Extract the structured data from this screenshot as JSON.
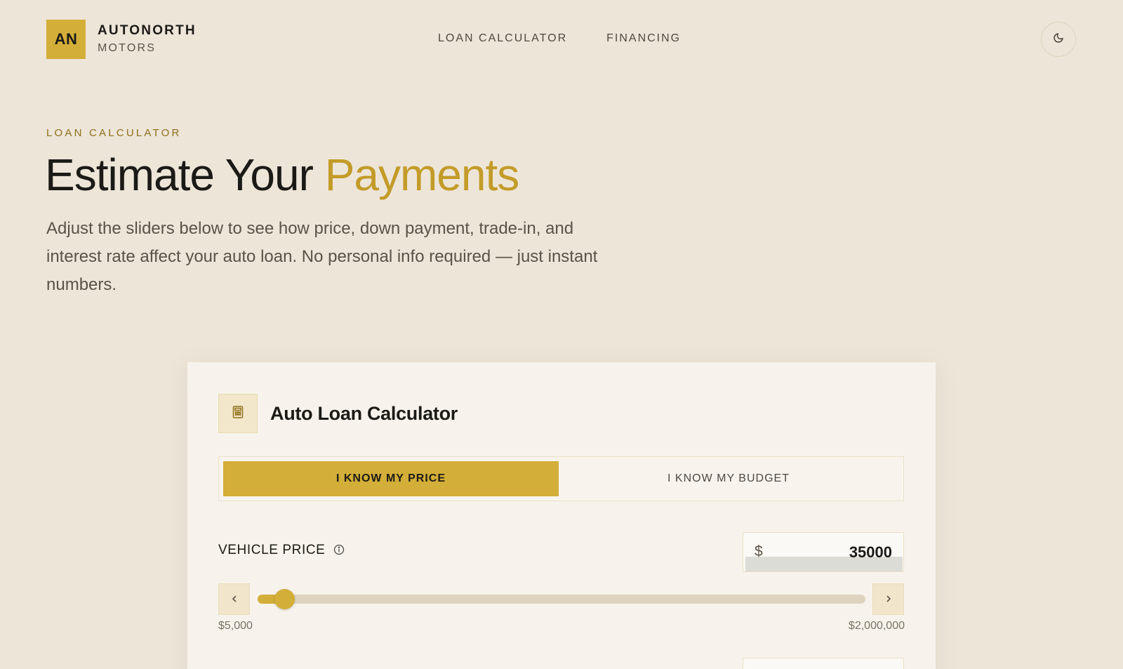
{
  "brand": {
    "monogram": "AN",
    "name": "AUTONORTH",
    "sub": "MOTORS",
    "accent_color": "#d3ae38"
  },
  "nav": {
    "items": [
      "LOAN CALCULATOR",
      "FINANCING"
    ]
  },
  "theme_toggle": {
    "icon": "moon-icon"
  },
  "hero": {
    "eyebrow": "LOAN CALCULATOR",
    "title_main": "Estimate Your ",
    "title_accent": "Payments",
    "description": "Adjust the sliders below to see how price, down payment, trade-in, and interest rate affect your auto loan. No personal info required — just instant numbers."
  },
  "calculator": {
    "icon": "calculator-icon",
    "title": "Auto Loan Calculator",
    "modes": [
      {
        "label": "I KNOW MY PRICE",
        "active": true
      },
      {
        "label": "I KNOW MY BUDGET",
        "active": false
      }
    ],
    "vehicle_price": {
      "label": "VEHICLE PRICE",
      "info_icon": "info-icon",
      "currency": "$",
      "value": "35000",
      "min_label": "$5,000",
      "max_label": "$2,000,000",
      "min": 5000,
      "max": 2000000,
      "current": 35000,
      "decrement_icon": "chevron-left-icon",
      "increment_icon": "chevron-right-icon"
    }
  }
}
